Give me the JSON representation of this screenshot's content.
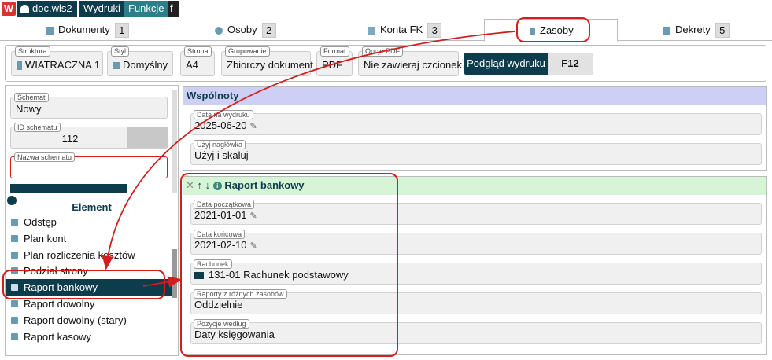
{
  "topbar": {
    "logo": "W",
    "user_label": "doc.wls2",
    "wydruki": "Wydruki",
    "funkcje": "Funkcje",
    "f": "f",
    "colors": {
      "user_bg": "#0d3d4d",
      "wydruki_bg": "#0d3d4d",
      "funkcje_bg": "#2a7f8a",
      "f_bg": "#222"
    }
  },
  "tabs": [
    {
      "label": "Dokumenty",
      "num": "1",
      "icon": "document-icon"
    },
    {
      "label": "Osoby",
      "num": "2",
      "icon": "people-icon"
    },
    {
      "label": "Konta FK",
      "num": "3",
      "icon": "folder-icon"
    },
    {
      "label": "Zasoby",
      "num": "",
      "icon": "building-icon",
      "active": true
    },
    {
      "label": "Dekrety",
      "num": "5",
      "icon": "document-icon"
    }
  ],
  "toolbar": {
    "struktura": {
      "label": "Struktura",
      "value": "WIATRACZNA 1"
    },
    "styl": {
      "label": "Styl",
      "value": "Domyślny"
    },
    "strona": {
      "label": "Strona",
      "value": "A4"
    },
    "grupowanie": {
      "label": "Grupowanie",
      "value": "Zbiorczy dokument"
    },
    "format": {
      "label": "Format",
      "value": "PDF"
    },
    "opcje": {
      "label": "Opcje PDF",
      "value": "Nie zawieraj czcionek"
    },
    "preview": "Podgląd wydruku",
    "f12": "F12"
  },
  "left": {
    "schemat": {
      "label": "Schemat",
      "value": "Nowy"
    },
    "id_schematu": {
      "label": "ID schematu",
      "value": "112"
    },
    "nazwa": {
      "label": "Nazwa schematu",
      "value": ""
    },
    "element_header": "Element",
    "elements": [
      "Odstęp",
      "Plan kont",
      "Plan rozliczenia kosztów",
      "Podział strony",
      "Raport bankowy",
      "Raport dowolny",
      "Raport dowolny (stary)",
      "Raport kasowy"
    ],
    "selected_index": 4
  },
  "wspolnoty": {
    "title": "Wspólnoty",
    "fields": [
      {
        "label": "Data na wydruku",
        "value": "2025-06-20"
      },
      {
        "label": "Użyj nagłówka",
        "value": "Użyj i skaluj"
      }
    ]
  },
  "raport": {
    "title": "Raport bankowy",
    "fields": [
      {
        "label": "Data początkowa",
        "value": "2021-01-01"
      },
      {
        "label": "Data końcowa",
        "value": "2021-02-10"
      },
      {
        "label": "Rachunek",
        "value": "131-01 Rachunek podstawowy"
      },
      {
        "label": "Raporty z różnych zasobów",
        "value": "Oddzielnie"
      },
      {
        "label": "Pozycje według",
        "value": "Daty księgowania"
      }
    ]
  },
  "colors": {
    "annotation_red": "#d21e1e",
    "wspolnoty_header": "#cdcff5",
    "raport_header": "#d6f5d6",
    "dark_teal": "#0d3d4d"
  }
}
